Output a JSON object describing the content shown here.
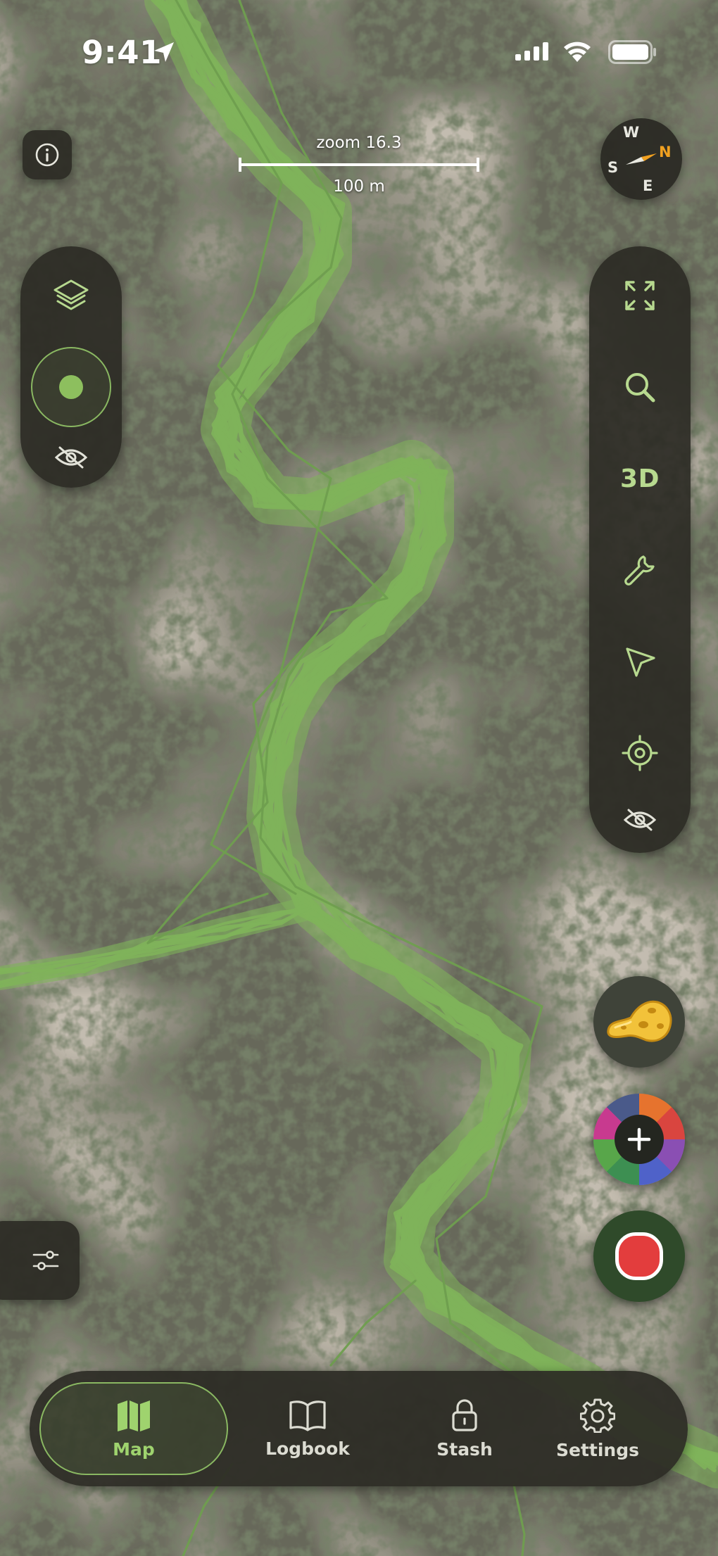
{
  "status_bar": {
    "time": "9:41",
    "icons": [
      "location-arrow-icon",
      "cellular-signal-icon",
      "wifi-icon",
      "battery-icon"
    ]
  },
  "map": {
    "zoom_label": "zoom 16.3",
    "scale_label": "100 m",
    "track_color": "#7fb35a"
  },
  "compass": {
    "north": "N",
    "east": "E",
    "south": "S",
    "west": "W"
  },
  "left_controls": [
    "layers-icon",
    "location-dot-icon",
    "hide-eye-icon"
  ],
  "right_controls": {
    "items": [
      "expand-icon",
      "search-icon",
      "3d-toggle",
      "wrench-icon",
      "navigation-arrow-icon",
      "crosshair-icon",
      "hide-eye-icon"
    ],
    "three_d_label": "3D"
  },
  "fabs": [
    "gold-nugget-icon",
    "add-waypoint-icon",
    "record-icon"
  ],
  "tabs": [
    {
      "label": "Map",
      "icon": "map-icon",
      "active": true
    },
    {
      "label": "Logbook",
      "icon": "book-icon",
      "active": false
    },
    {
      "label": "Stash",
      "icon": "lock-icon",
      "active": false
    },
    {
      "label": "Settings",
      "icon": "gear-icon",
      "active": false
    }
  ],
  "colors": {
    "accent": "#9fd36e",
    "panel": "#2c2b25",
    "record": "#e33d3d",
    "compass_needle_north": "#f0a020"
  }
}
